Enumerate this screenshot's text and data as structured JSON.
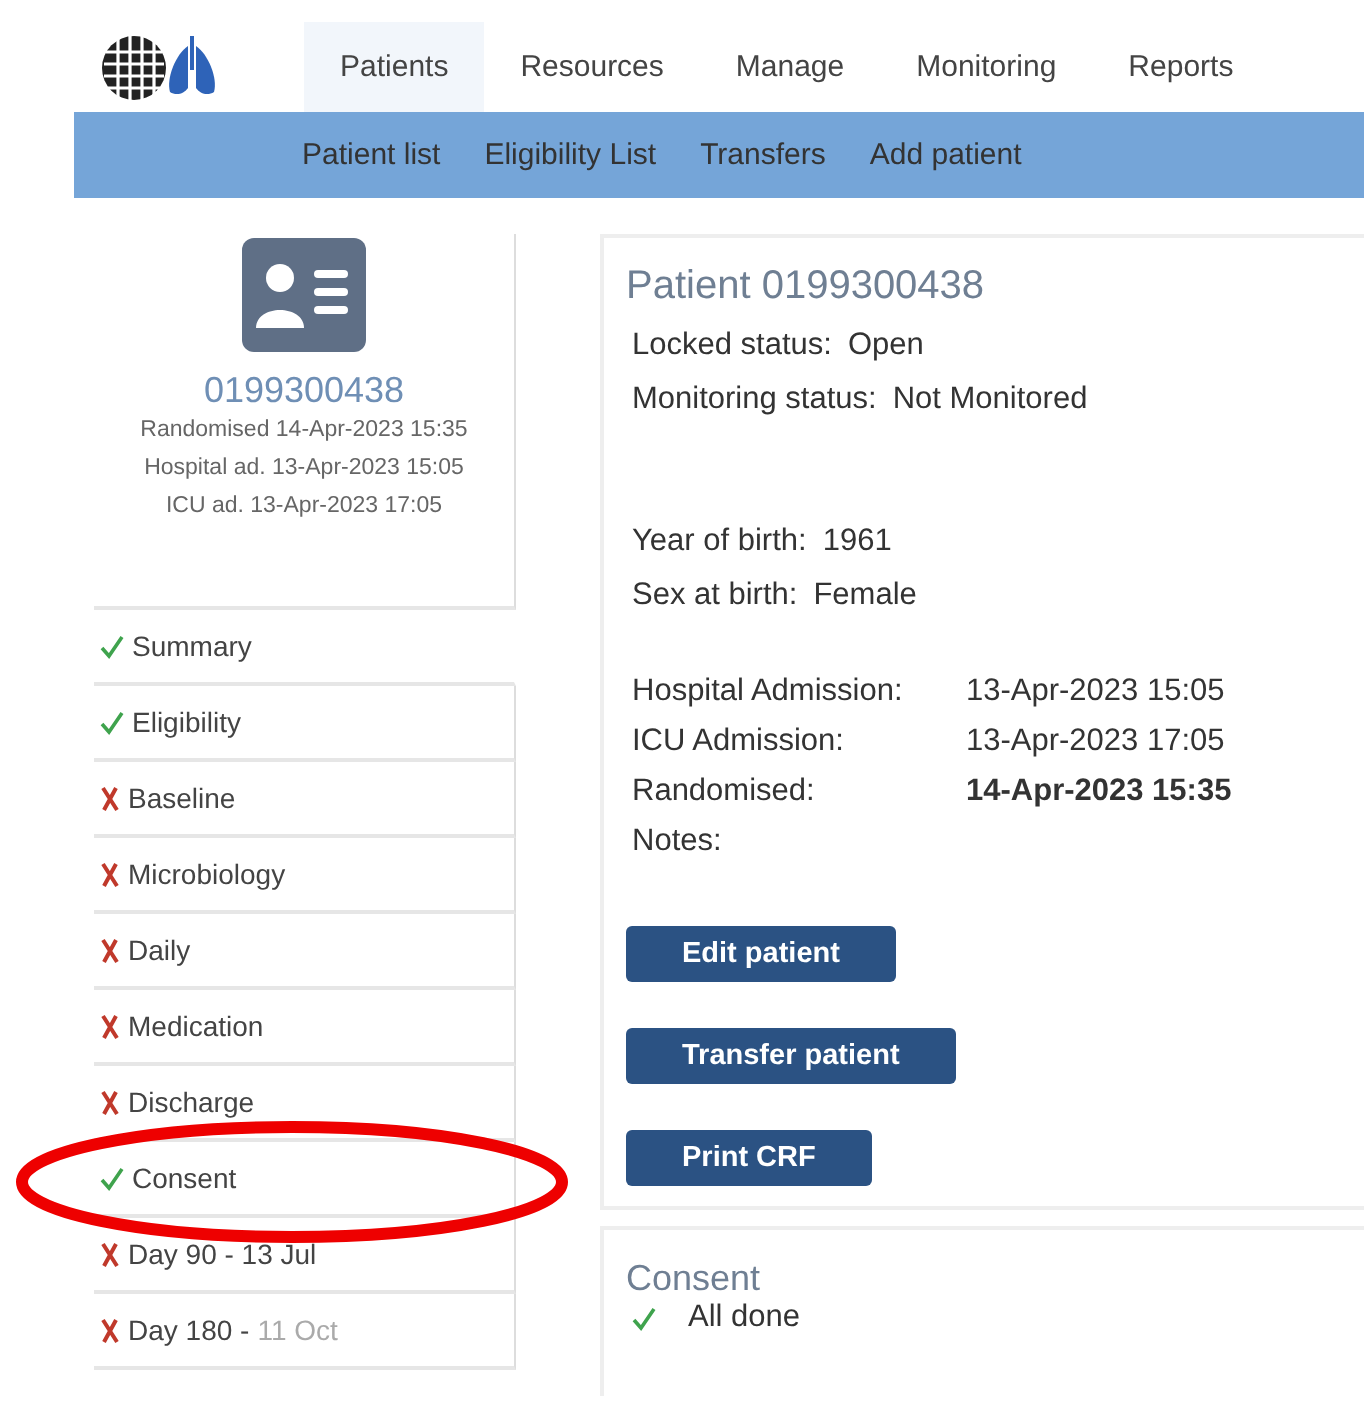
{
  "nav": {
    "tabs": [
      {
        "label": "Patients",
        "selected": true
      },
      {
        "label": "Resources",
        "selected": false
      },
      {
        "label": "Manage",
        "selected": false
      },
      {
        "label": "Monitoring",
        "selected": false
      },
      {
        "label": "Reports",
        "selected": false
      }
    ],
    "subnav": [
      "Patient list",
      "Eligibility List",
      "Transfers",
      "Add patient"
    ]
  },
  "patient_card": {
    "id": "0199300438",
    "lines": [
      "Randomised 14-Apr-2023 15:35",
      "Hospital ad. 13-Apr-2023 15:05",
      "ICU ad. 13-Apr-2023 17:05"
    ]
  },
  "sidebar": {
    "items": [
      {
        "label": "Summary",
        "done": true,
        "selected": true,
        "circled": false
      },
      {
        "label": "Eligibility",
        "done": true,
        "selected": false,
        "circled": false
      },
      {
        "label": "Baseline",
        "done": false,
        "selected": false,
        "circled": false
      },
      {
        "label": "Microbiology",
        "done": false,
        "selected": false,
        "circled": false
      },
      {
        "label": "Daily",
        "done": false,
        "selected": false,
        "circled": false
      },
      {
        "label": "Medication",
        "done": false,
        "selected": false,
        "circled": false
      },
      {
        "label": "Discharge",
        "done": false,
        "selected": false,
        "circled": false
      },
      {
        "label": "Consent",
        "done": true,
        "selected": false,
        "circled": true
      },
      {
        "label": "Day 90 - 13 Jul",
        "done": false,
        "selected": false,
        "circled": false
      },
      {
        "label": "Day 180 -",
        "note": "11 Oct",
        "done": false,
        "selected": false,
        "circled": false
      }
    ]
  },
  "patient": {
    "title": "Patient 0199300438",
    "groups": [
      {
        "kind": "inline",
        "fields": [
          {
            "label": "Locked status:",
            "value": "Open"
          },
          {
            "label": "Monitoring status:",
            "value": "Not Monitored"
          }
        ]
      },
      {
        "kind": "inline",
        "fields": [
          {
            "label": "Year of birth:",
            "value": "1961"
          },
          {
            "label": "Sex at birth:",
            "value": "Female"
          }
        ]
      },
      {
        "kind": "aligned",
        "fields": [
          {
            "label": "Hospital Admission:",
            "value": "13-Apr-2023 15:05"
          },
          {
            "label": "ICU Admission:",
            "value": "13-Apr-2023 17:05"
          },
          {
            "label": "Randomised:",
            "value": "14-Apr-2023 15:35",
            "bold": true
          },
          {
            "label": "Notes:"
          }
        ]
      }
    ],
    "buttons": [
      "Edit patient",
      "Transfer patient",
      "Print CRF"
    ]
  },
  "consent": {
    "title": "Consent",
    "status": "All done",
    "done": true
  }
}
